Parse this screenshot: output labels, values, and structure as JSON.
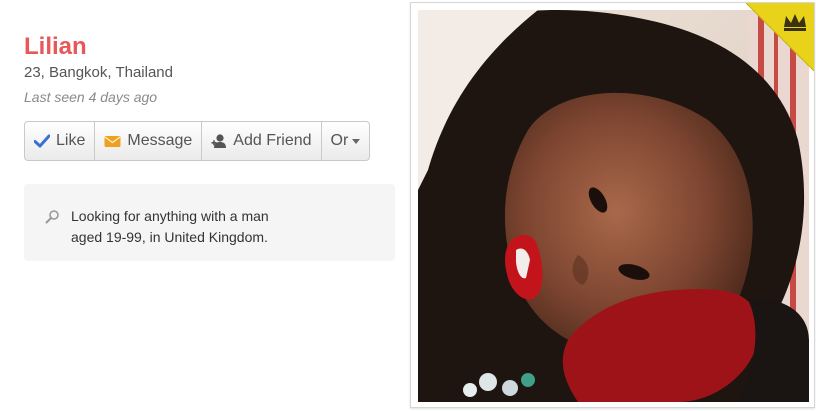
{
  "profile": {
    "name": "Lilian",
    "location": "23, Bangkok, Thailand",
    "last_seen": "Last seen 4 days ago"
  },
  "actions": {
    "like_label": "Like",
    "message_label": "Message",
    "add_friend_label": "Add Friend",
    "or_label": "Or"
  },
  "looking_for": {
    "text": "Looking for anything with a man aged 19-99, in United Kingdom."
  },
  "icons": {
    "like": "checkmark-icon",
    "message": "envelope-icon",
    "add_friend": "person-add-icon",
    "search": "search-icon",
    "premium": "crown-icon"
  },
  "colors": {
    "name": "#e8575a",
    "like_icon": "#3a6fd6",
    "message_icon": "#f0a020",
    "premium_badge": "#e8d21a"
  }
}
